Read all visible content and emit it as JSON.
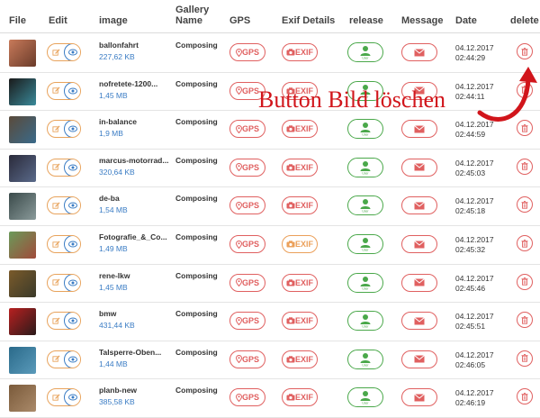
{
  "header": {
    "file": "File",
    "edit": "Edit",
    "image": "image",
    "gallery_name_line1": "Gallery",
    "gallery_name_line2": "Name",
    "gps": "GPS",
    "exif": "Exif Details",
    "release": "release",
    "message": "Message",
    "date": "Date",
    "delete": "delete"
  },
  "buttons": {
    "gps_label": "GPS",
    "exif_label": "EXIF",
    "release_sub": "User"
  },
  "annotation": {
    "text": "Button Bild löschen"
  },
  "colors": {
    "orange": "#e8a35c",
    "blue": "#3a7cc4",
    "red": "#e06060",
    "green": "#4aa84a",
    "annotation_red": "#d1151b"
  },
  "rows": [
    {
      "name": "ballonfahrt",
      "size": "227,62 KB",
      "gallery": "Composing",
      "date": "04.12.2017",
      "time": "02:44:29",
      "exif_state": "normal",
      "thumb": [
        "#c87a5a",
        "#6a3b2a"
      ]
    },
    {
      "name": "nofretete-1200...",
      "size": "1,45 MB",
      "gallery": "Composing",
      "date": "04.12.2017",
      "time": "02:44:11",
      "exif_state": "normal",
      "thumb": [
        "#1a1a1a",
        "#3a8a9a"
      ]
    },
    {
      "name": "in-balance",
      "size": "1,9 MB",
      "gallery": "Composing",
      "date": "04.12.2017",
      "time": "02:44:59",
      "exif_state": "normal",
      "thumb": [
        "#5a4a3a",
        "#3a6a8a"
      ]
    },
    {
      "name": "marcus-motorrad...",
      "size": "320,64 KB",
      "gallery": "Composing",
      "date": "04.12.2017",
      "time": "02:45:03",
      "exif_state": "normal",
      "thumb": [
        "#2a2a3a",
        "#5a6a8a"
      ]
    },
    {
      "name": "de-ba",
      "size": "1,54 MB",
      "gallery": "Composing",
      "date": "04.12.2017",
      "time": "02:45:18",
      "exif_state": "normal",
      "thumb": [
        "#3a4a4a",
        "#8a9a9a"
      ]
    },
    {
      "name": "Fotografie_&_Co...",
      "size": "1,49 MB",
      "gallery": "Composing",
      "date": "04.12.2017",
      "time": "02:45:32",
      "exif_state": "orange",
      "thumb": [
        "#6a9a5a",
        "#a04a3a"
      ]
    },
    {
      "name": "rene-lkw",
      "size": "1,45 MB",
      "gallery": "Composing",
      "date": "04.12.2017",
      "time": "02:45:46",
      "exif_state": "normal",
      "thumb": [
        "#7a5a2a",
        "#3a3a2a"
      ]
    },
    {
      "name": "bmw",
      "size": "431,44 KB",
      "gallery": "Composing",
      "date": "04.12.2017",
      "time": "02:45:51",
      "exif_state": "normal",
      "thumb": [
        "#b82020",
        "#2a1a1a"
      ]
    },
    {
      "name": "Talsperre-Oben...",
      "size": "1,44 MB",
      "gallery": "Composing",
      "date": "04.12.2017",
      "time": "02:46:05",
      "exif_state": "normal",
      "thumb": [
        "#2a6a8a",
        "#5a9aba"
      ]
    },
    {
      "name": "planb-new",
      "size": "385,58 KB",
      "gallery": "Composing",
      "date": "04.12.2017",
      "time": "02:46:19",
      "exif_state": "normal",
      "thumb": [
        "#7a5a3a",
        "#aa8a6a"
      ]
    }
  ]
}
